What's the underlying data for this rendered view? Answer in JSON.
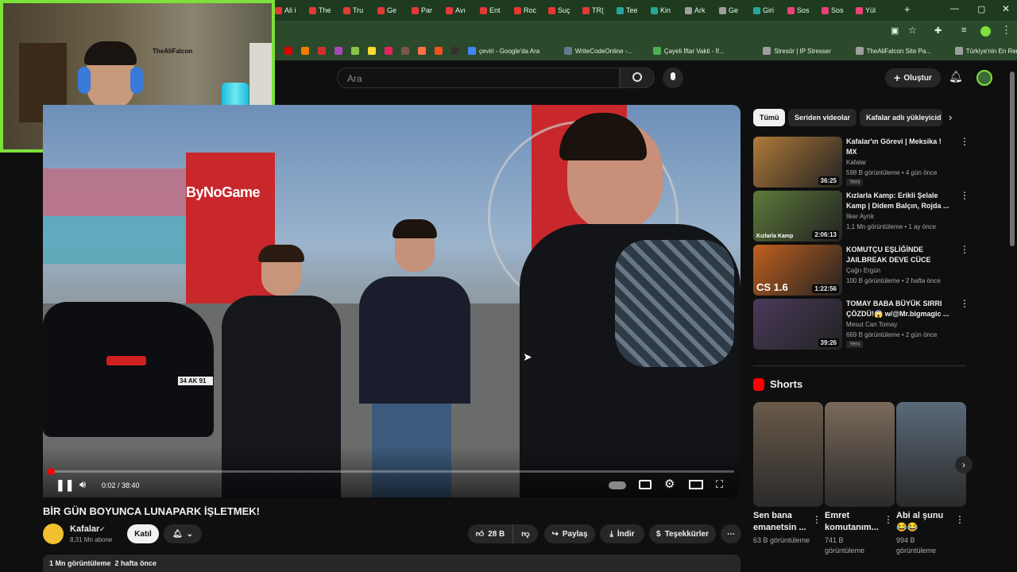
{
  "browser": {
    "tabs": [
      "Ali i",
      "The",
      "Tru",
      "Ge",
      "Par",
      "Avı",
      "Ent",
      "Roc",
      "Suç",
      "TR(",
      "Tee",
      "Kin",
      "Ark",
      "Ge",
      "Giri",
      "Sos",
      "Sos",
      "Yül"
    ],
    "new_tab": "+",
    "bookmarks": [
      {
        "label": "",
        "color": "#e00000"
      },
      {
        "label": "",
        "color": "#f57c00"
      },
      {
        "label": "",
        "color": "#d32f2f"
      },
      {
        "label": "",
        "color": "#ab47bc"
      },
      {
        "label": "",
        "color": "#8bc34a"
      },
      {
        "label": "",
        "color": "#fdd835"
      },
      {
        "label": "",
        "color": "#e91e63"
      },
      {
        "label": "",
        "color": "#795548"
      },
      {
        "label": "",
        "color": "#ff7043"
      },
      {
        "label": "",
        "color": "#f4511e"
      },
      {
        "label": "",
        "color": "#333333"
      },
      {
        "label": "çeviri - Google'da Ara",
        "color": "#4285f4"
      },
      {
        "label": "WriteCodeOnline -...",
        "color": "#607d8b"
      },
      {
        "label": "Çayeli İftar Vakti - İf...",
        "color": "#4caf50"
      },
      {
        "label": "Stresör | IP Stresser",
        "color": "#9e9e9e"
      },
      {
        "label": "TheAliFalcon Site Pa...",
        "color": "#9e9e9e"
      },
      {
        "label": "Türkiye'nin En Renkl...",
        "color": "#9e9e9e"
      }
    ]
  },
  "webcam": {
    "label": "TheAliFalcon"
  },
  "header": {
    "search_placeholder": "Ara",
    "create_label": "Oluştur"
  },
  "player": {
    "time": "0:02 / 38:40",
    "progress": 0.001,
    "overlay_logo": "ByNoGame",
    "plate": "34 AK 91"
  },
  "video": {
    "title": "BİR GÜN BOYUNCA LUNAPARK İŞLETMEK!",
    "channel": "Kafalar",
    "subscribers": "8,31 Mn abone",
    "join_label": "Katıl",
    "likes": "28 B",
    "share_label": "Paylaş",
    "download_label": "İndir",
    "thanks_label": "Teşekkürler",
    "views_date": "1 Mn görüntüleme  2 hafta önce"
  },
  "chips": [
    "Tümü",
    "Seriden videolar",
    "Kafalar adlı yükleyicid"
  ],
  "recommendations": [
    {
      "title": "Kafalar'ın Görevi | Meksika ! MX",
      "channel": "Kafalar",
      "meta": "598 B görüntüleme • 4 gün önce",
      "duration": "36:25",
      "badge": "Yeni",
      "thumb_color": "#b07a3a"
    },
    {
      "title": "Kızlarla Kamp: Erikli Şelale Kamp | Didem Balçın, Rojda ...",
      "channel": "İlker Ayrık",
      "meta": "1,1 Mn görüntüleme • 1 ay önce",
      "duration": "2:06:13",
      "badge": "",
      "thumb_label": "Kızlarla Kamp",
      "thumb_color": "#5d7a3a"
    },
    {
      "title": "KOMUTÇU EŞLİĞİNDE JAILBREAK DEVE CÜCE OYUN...",
      "channel": "Çağrı Ergün",
      "meta": "100 B görüntüleme • 2 hafta önce",
      "duration": "1:22:56",
      "badge": "",
      "thumb_label": "CS 1.6",
      "thumb_color": "#c0601e"
    },
    {
      "title": "TOMAY BABA BÜYÜK SIRRI ÇÖZDÜ!😱 w/@Mr.bigmagic ...",
      "channel": "Mesut Can Tomay",
      "meta": "669 B görüntüleme • 2 gün önce",
      "duration": "39:26",
      "badge": "Yeni",
      "thumb_color": "#4a3a5a"
    }
  ],
  "shorts": {
    "heading": "Shorts",
    "items": [
      {
        "title": "Sen bana emanetsin ...",
        "views": "63 B görüntüleme",
        "color": "#6a5a4a"
      },
      {
        "title": "Emret komutanım...",
        "views": "741 B görüntüleme",
        "color": "#7a6a5a"
      },
      {
        "title": "Abi al şunu 😂😂",
        "views": "994 B görüntüleme",
        "color": "#5a6a7a"
      }
    ]
  }
}
